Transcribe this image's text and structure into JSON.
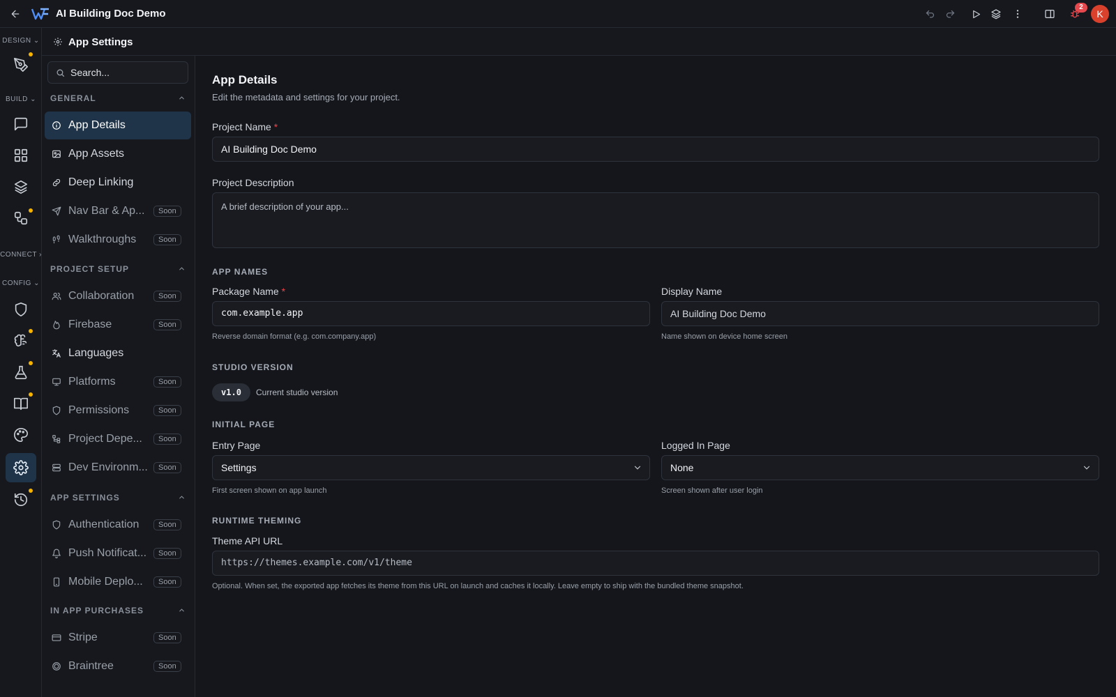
{
  "header": {
    "title": "AI Building Doc Demo",
    "notifications_count": "2",
    "avatar_initial": "K",
    "icons": [
      "back-arrow-icon",
      "logo-icon",
      "undo-icon",
      "redo-icon",
      "play-icon",
      "layers-icon",
      "more-vertical-icon",
      "panel-icon",
      "bug-icon"
    ]
  },
  "rail": {
    "sections": {
      "design": "DESIGN",
      "build": "BUILD",
      "connect": "CONNECT",
      "config": "CONFIG"
    },
    "active": "settings-icon",
    "dot_color": "#f5b300"
  },
  "subheader": {
    "title": "App Settings"
  },
  "sidebar": {
    "search_placeholder": "Search...",
    "soon_label": "Soon",
    "sections": [
      {
        "label": "GENERAL",
        "items": [
          {
            "label": "App Details",
            "icon": "info-icon",
            "active": true
          },
          {
            "label": "App Assets",
            "icon": "image-icon"
          },
          {
            "label": "Deep Linking",
            "icon": "link-icon"
          },
          {
            "label": "Nav Bar & Ap...",
            "icon": "send-icon",
            "soon": true
          },
          {
            "label": "Walkthroughs",
            "icon": "footprints-icon",
            "soon": true
          }
        ]
      },
      {
        "label": "PROJECT SETUP",
        "items": [
          {
            "label": "Collaboration",
            "icon": "users-icon",
            "soon": true
          },
          {
            "label": "Firebase",
            "icon": "flame-icon",
            "soon": true
          },
          {
            "label": "Languages",
            "icon": "translate-icon"
          },
          {
            "label": "Platforms",
            "icon": "monitor-icon",
            "soon": true
          },
          {
            "label": "Permissions",
            "icon": "shield-icon",
            "soon": true
          },
          {
            "label": "Project Depe...",
            "icon": "dependencies-icon",
            "soon": true
          },
          {
            "label": "Dev Environm...",
            "icon": "server-icon",
            "soon": true
          }
        ]
      },
      {
        "label": "APP SETTINGS",
        "items": [
          {
            "label": "Authentication",
            "icon": "shield-icon",
            "soon": true
          },
          {
            "label": "Push Notificat...",
            "icon": "bell-icon",
            "soon": true
          },
          {
            "label": "Mobile Deplo...",
            "icon": "smartphone-icon",
            "soon": true
          }
        ]
      },
      {
        "label": "IN APP PURCHASES",
        "items": [
          {
            "label": "Stripe",
            "icon": "credit-card-icon",
            "soon": true
          },
          {
            "label": "Braintree",
            "icon": "coin-icon",
            "soon": true
          }
        ]
      }
    ]
  },
  "main": {
    "title": "App Details",
    "subtitle": "Edit the metadata and settings for your project.",
    "project_name": {
      "label": "Project Name",
      "required": "*",
      "value": "AI Building Doc Demo"
    },
    "project_description": {
      "label": "Project Description",
      "placeholder": "A brief description of your app..."
    },
    "app_names": {
      "heading": "APP NAMES",
      "package_name": {
        "label": "Package Name",
        "required": "*",
        "value": "com.example.app",
        "help": "Reverse domain format (e.g. com.company.app)"
      },
      "display_name": {
        "label": "Display Name",
        "value": "AI Building Doc Demo",
        "help": "Name shown on device home screen"
      }
    },
    "studio_version": {
      "heading": "STUDIO VERSION",
      "version": "v1.0",
      "caption": "Current studio version"
    },
    "initial_page": {
      "heading": "INITIAL PAGE",
      "entry_page": {
        "label": "Entry Page",
        "value": "Settings",
        "help": "First screen shown on app launch"
      },
      "logged_in_page": {
        "label": "Logged In Page",
        "value": "None",
        "help": "Screen shown after user login"
      }
    },
    "runtime_theming": {
      "heading": "RUNTIME THEMING",
      "theme_api_url": {
        "label": "Theme API URL",
        "placeholder": "https://themes.example.com/v1/theme",
        "help": "Optional. When set, the exported app fetches its theme from this URL on launch and caches it locally. Leave empty to ship with the bundled theme snapshot."
      }
    }
  }
}
